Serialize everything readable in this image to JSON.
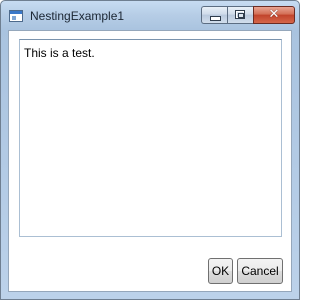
{
  "window": {
    "title": "NestingExample1",
    "app_icon": "window-app-icon",
    "caption_buttons": {
      "minimize_icon": "minimize-icon",
      "maximize_icon": "maximize-icon",
      "close_icon": "close-icon",
      "close_glyph": "✕"
    }
  },
  "main": {
    "textbox_value": "This is a test."
  },
  "footer": {
    "ok_label": "OK",
    "cancel_label": "Cancel"
  },
  "colors": {
    "title_bar": "#b6cde6",
    "close_button": "#c1432b",
    "client_background": "#ffffff"
  }
}
